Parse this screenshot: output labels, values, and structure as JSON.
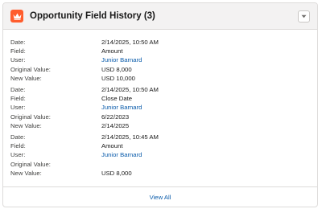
{
  "card": {
    "title": "Opportunity Field History (3)",
    "icon": "crown-icon",
    "accent_color": "#ff5d2d"
  },
  "labels": {
    "date": "Date:",
    "field": "Field:",
    "user": "User:",
    "original_value": "Original Value:",
    "new_value": "New Value:"
  },
  "records": [
    {
      "date": "2/14/2025, 10:50 AM",
      "field": "Amount",
      "user": "Junior Barnard",
      "original_value": "USD 8,000",
      "new_value": "USD 10,000"
    },
    {
      "date": "2/14/2025, 10:50 AM",
      "field": "Close Date",
      "user": "Junior Barnard",
      "original_value": "6/22/2023",
      "new_value": "2/14/2025"
    },
    {
      "date": "2/14/2025, 10:45 AM",
      "field": "Amount",
      "user": "Junior Barnard",
      "original_value": "",
      "new_value": "USD 8,000"
    }
  ],
  "footer": {
    "view_all": "View All"
  }
}
